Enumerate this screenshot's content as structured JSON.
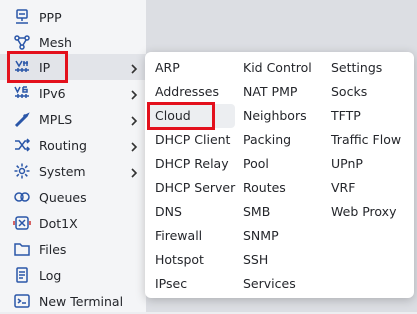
{
  "sidebar": {
    "items": [
      {
        "label": "PPP",
        "icon": "ppp-icon",
        "has_submenu": false
      },
      {
        "label": "Mesh",
        "icon": "mesh-icon",
        "has_submenu": false
      },
      {
        "label": "IP",
        "icon": "ip-icon",
        "has_submenu": true
      },
      {
        "label": "IPv6",
        "icon": "ipv6-icon",
        "has_submenu": true
      },
      {
        "label": "MPLS",
        "icon": "mpls-icon",
        "has_submenu": true
      },
      {
        "label": "Routing",
        "icon": "routing-icon",
        "has_submenu": true
      },
      {
        "label": "System",
        "icon": "system-gear-icon",
        "has_submenu": true
      },
      {
        "label": "Queues",
        "icon": "queues-icon",
        "has_submenu": false
      },
      {
        "label": "Dot1X",
        "icon": "dot1x-icon",
        "has_submenu": false
      },
      {
        "label": "Files",
        "icon": "folder-icon",
        "has_submenu": false
      },
      {
        "label": "Log",
        "icon": "log-icon",
        "has_submenu": false
      },
      {
        "label": "New Terminal",
        "icon": "terminal-icon",
        "has_submenu": false
      }
    ],
    "active": "IP"
  },
  "ip_submenu": {
    "columns": [
      [
        "ARP",
        "Addresses",
        "Cloud",
        "DHCP Client",
        "DHCP Relay",
        "DHCP Server",
        "DNS",
        "Firewall",
        "Hotspot",
        "IPsec"
      ],
      [
        "Kid Control",
        "NAT PMP",
        "Neighbors",
        "Packing",
        "Pool",
        "Routes",
        "SMB",
        "SNMP",
        "SSH",
        "Services"
      ],
      [
        "Settings",
        "Socks",
        "TFTP",
        "Traffic Flow",
        "UPnP",
        "VRF",
        "Web Proxy"
      ]
    ],
    "hovered": "Cloud"
  },
  "colors": {
    "icon_blue": "#2a56a8",
    "highlight_red": "#e3101c",
    "sidebar_bg": "#f4f5f7",
    "menu_bg": "#ffffff"
  }
}
